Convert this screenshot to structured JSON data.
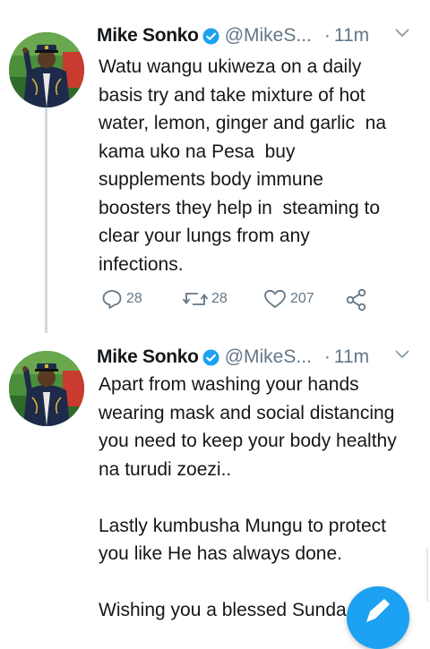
{
  "colors": {
    "accent": "#1da1f2",
    "muted": "#657786",
    "text": "#14171a"
  },
  "tweets": [
    {
      "name": "Mike Sonko",
      "handle": "@MikeS...",
      "dot": "·",
      "time": "11m",
      "body": "Watu wangu ukiweza on a daily\nbasis try and take mixture of hot\nwater, lemon, ginger and garlic  na\nkama uko na Pesa  buy\nsupplements body immune\nboosters they help in  steaming to\nclear your lungs from any\ninfections.",
      "replies": "28",
      "retweets": "28",
      "likes": "207",
      "icons": {
        "reply": "reply-icon",
        "retweet": "retweet-icon",
        "like": "heart-icon",
        "share": "share-icon",
        "verified": "verified-badge-icon",
        "menu": "chevron-down-icon"
      }
    },
    {
      "name": "Mike Sonko",
      "handle": "@MikeS...",
      "dot": "·",
      "time": "11m",
      "body": "Apart from washing your hands\nwearing mask and social distancing\nyou need to keep your body healthy\nna turudi zoezi..\n\nLastly kumbusha Mungu to protect\nyou like He has always done.\n\nWishing you a blessed Sunda"
    }
  ],
  "fab": {
    "icon": "compose-tweet-icon"
  }
}
